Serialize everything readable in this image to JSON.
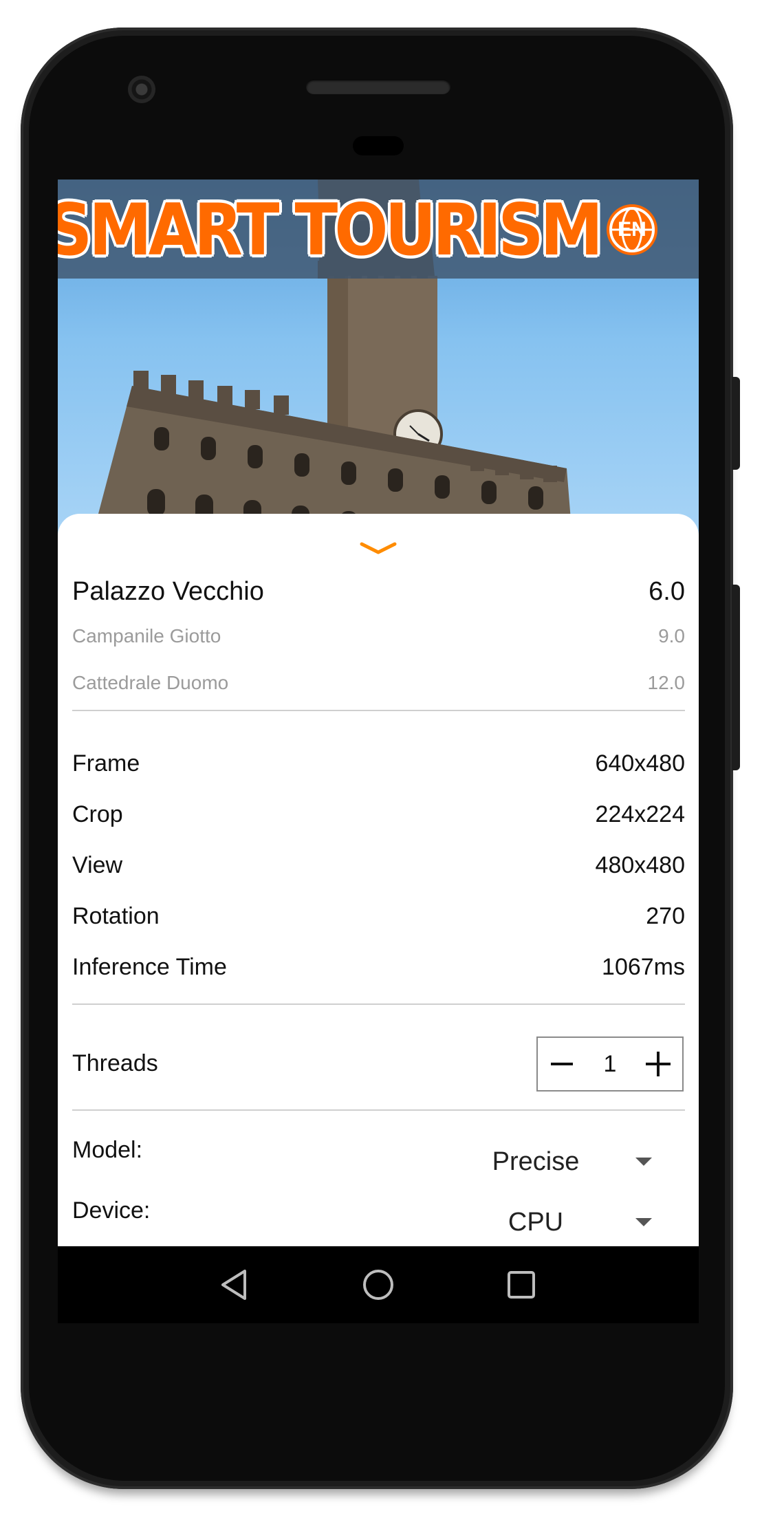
{
  "app": {
    "logo_text": "SMART TOURISM",
    "language_badge": "EN",
    "accent_color": "#ff6a00"
  },
  "recognitions": {
    "top": {
      "name": "Palazzo Vecchio",
      "score": "6.0"
    },
    "others": [
      {
        "name": "Campanile Giotto",
        "score": "9.0"
      },
      {
        "name": "Cattedrale Duomo",
        "score": "12.0"
      }
    ]
  },
  "info": [
    {
      "label": "Frame",
      "value": "640x480"
    },
    {
      "label": "Crop",
      "value": "224x224"
    },
    {
      "label": "View",
      "value": "480x480"
    },
    {
      "label": "Rotation",
      "value": "270"
    },
    {
      "label": "Inference Time",
      "value": "1067ms"
    }
  ],
  "threads": {
    "label": "Threads",
    "value": "1"
  },
  "model": {
    "label": "Model:",
    "value": "Precise"
  },
  "device": {
    "label": "Device:",
    "value": "CPU"
  },
  "icons": {
    "collapse": "chevron-down-icon",
    "minus": "minus-icon",
    "plus": "plus-icon",
    "back": "nav-back-icon",
    "home": "nav-home-icon",
    "recents": "nav-recents-icon",
    "language": "globe-icon"
  }
}
